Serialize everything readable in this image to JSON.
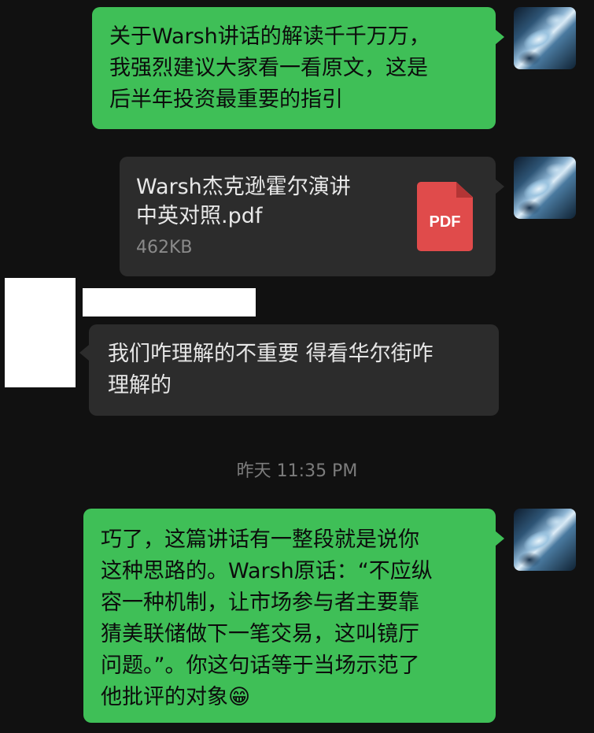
{
  "messages": [
    {
      "side": "right",
      "text": "关于Warsh讲话的解读千千万万，\n我强烈建议大家看一看原文，这是\n后半年投资最重要的指引"
    },
    {
      "side": "right",
      "file": {
        "name": "Warsh杰克逊霍尔演讲\n中英对照.pdf",
        "size": "462KB",
        "type_label": "PDF"
      }
    },
    {
      "side": "left",
      "text": "我们咋理解的不重要 得看华尔街咋\n理解的"
    },
    {
      "side": "right",
      "text": "巧了，这篇讲话有一整段就是说你\n这种思路的。Warsh原话：“不应纵\n容一种机制，让市场参与者主要靠\n猜美联储做下一笔交易，这叫镜厅\n问题。”。你这句话等于当场示范了\n他批评的对象😁"
    }
  ],
  "timestamp": "昨天 11:35 PM",
  "icons": {
    "avatar": "avatar-image",
    "file": "pdf-file-icon",
    "emoji": "grinning-face-emoji"
  },
  "colors": {
    "background": "#111111",
    "outgoing_bubble": "#3fbf57",
    "incoming_bubble": "#2c2c2c",
    "pdf_icon": "#e04b4b"
  }
}
